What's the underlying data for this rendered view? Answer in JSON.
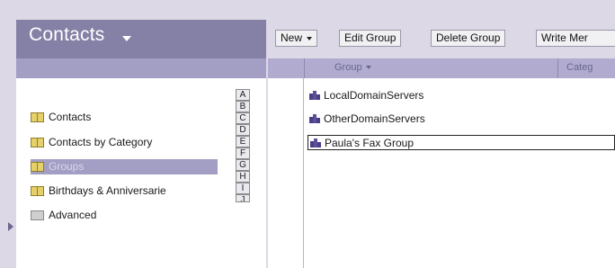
{
  "app": {
    "title": "Contacts"
  },
  "toolbar": {
    "new_label": "New",
    "edit_group_label": "Edit Group",
    "delete_group_label": "Delete Group",
    "write_memo_label": "Write Mer"
  },
  "columns": {
    "group": "Group",
    "category": "Categ"
  },
  "nav": {
    "items": [
      {
        "label": "Contacts",
        "icon": "address-book-icon",
        "selected": false
      },
      {
        "label": "Contacts by Category",
        "icon": "address-book-icon",
        "selected": false
      },
      {
        "label": "Groups",
        "icon": "address-book-icon",
        "selected": true
      },
      {
        "label": "Birthdays & Anniversarie",
        "icon": "address-book-icon",
        "selected": false
      },
      {
        "label": "Advanced",
        "icon": "folder-icon",
        "selected": false
      }
    ]
  },
  "letters": [
    "A",
    "B",
    "C",
    "D",
    "E",
    "F",
    "G",
    "H",
    "I",
    "J"
  ],
  "groups": [
    {
      "name": "LocalDomainServers",
      "selected": false
    },
    {
      "name": "OtherDomainServers",
      "selected": false
    },
    {
      "name": "Paula's Fax Group",
      "selected": true
    }
  ],
  "colors": {
    "title_bg": "#8580a6",
    "subbar": "#a39ec4",
    "selected_bg": "#a39ec4",
    "group_icon": "#4b3f86"
  }
}
